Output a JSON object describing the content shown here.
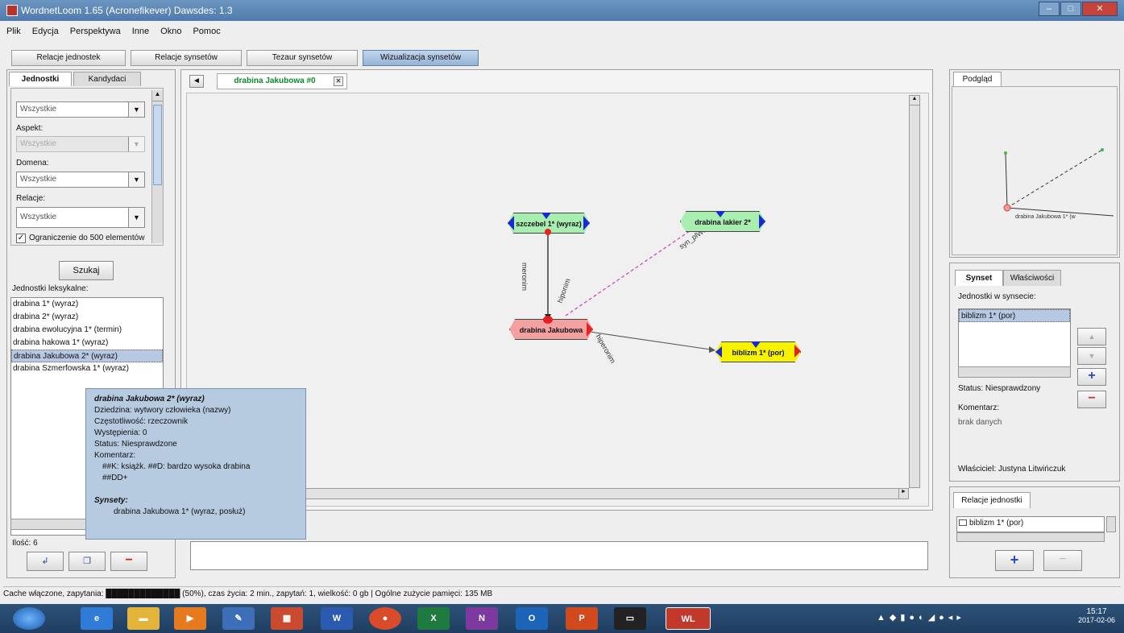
{
  "window": {
    "title": "WordnetLoom 1.65 (Acronefikever) Dawsdes: 1.3"
  },
  "menu": [
    "Plik",
    "Edycja",
    "Perspektywa",
    "Inne",
    "Okno",
    "Pomoc"
  ],
  "toolbar": [
    "Relacje jednostek",
    "Relacje synsetów",
    "Tezaur synsetów",
    "Wizualizacja synsetów"
  ],
  "left": {
    "tabs": [
      "Jednostki",
      "Kandydaci"
    ],
    "filters": [
      {
        "label": "",
        "value": "Wszystkie",
        "disabled": false
      },
      {
        "label": "Aspekt:",
        "value": "Wszystkie",
        "disabled": true
      },
      {
        "label": "Domena:",
        "value": "Wszystkie",
        "disabled": false
      },
      {
        "label": "Relacje:",
        "value": "Wszystkie",
        "disabled": false
      }
    ],
    "checkbox": "Ograniczenie do 500 elementów",
    "search_btn": "Szukaj",
    "results_label": "Jednostki leksykalne:",
    "results": [
      "drabina 1* (wyraz)",
      "drabina 2* (wyraz)",
      "drabina ewolucyjna 1* (termin)",
      "drabina hakowa 1* (wyraz)",
      "drabina Jakubowa 2* (wyraz)",
      "drabina Szmerfowska 1* (wyraz)"
    ],
    "count": "Ilość: 6"
  },
  "graph": {
    "tab": "drabina Jakubowa #0",
    "nodes": [
      "szczebel 1* (wyraz)",
      "drabina lakier 2*",
      "drabina Jakubowa",
      "biblizm 1* (por)"
    ],
    "edges": [
      "meronim",
      "hiponim",
      "syn_plWN",
      "hiperonim"
    ]
  },
  "tooltip": {
    "title": "drabina Jakubowa 2* (wyraz)",
    "lines": [
      "Dziedzina: wytwory człowieka (nazwy)",
      "Częstotliwość: rzeczownik",
      "Występienia: 0",
      "Status: Niesprawdzone",
      "Komentarz:",
      "  ##K: książk. ##D: bardzo wysoka drabina",
      "  ##DD+",
      "",
      "Synsety:",
      "  drabina Jakubowa 1* (wyraz, posłuż)"
    ]
  },
  "right": {
    "preview_tab": "Podgląd",
    "preview_caption": "drabina Jakubowa 1* (w",
    "props_tabs": [
      "Synset",
      "Właściwości"
    ],
    "units_label": "Jednostki w synsecie:",
    "units": [
      "biblizm 1* (por)"
    ],
    "status": "Status: Niesprawdzony",
    "comment_label": "Komentarz:",
    "comment": "brak danych",
    "owner": "Właściciel: Justyna Litwińczuk",
    "relations_tab": "Relacje jednostki",
    "relations": [
      "biblizm 1* (por)"
    ]
  },
  "statusbar": "Cache włączone, zapytania: █████████████ (50%), czas życia: 2 min., zapytań: 1, wielkość: 0 gb | Ogólne zużycie pamięci: 135 MB",
  "taskbar": {
    "time": "15:17",
    "date": "2017-02-06"
  }
}
